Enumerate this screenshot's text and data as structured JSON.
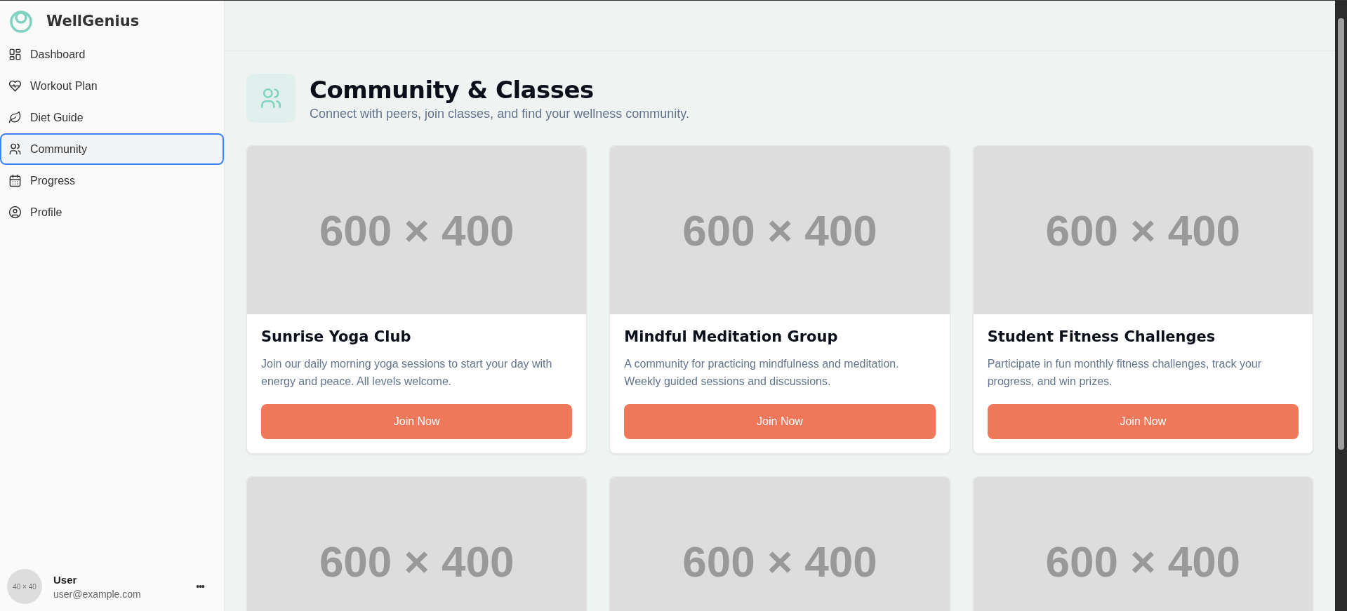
{
  "sidebar": {
    "brand": "WellGenius",
    "items": [
      {
        "label": "Dashboard",
        "selected": false
      },
      {
        "label": "Workout Plan",
        "selected": false
      },
      {
        "label": "Diet Guide",
        "selected": false
      },
      {
        "label": "Community",
        "selected": true
      },
      {
        "label": "Progress",
        "selected": false
      },
      {
        "label": "Profile",
        "selected": false
      }
    ],
    "user": {
      "avatar_label": "40 × 40",
      "name": "User",
      "email": "user@example.com",
      "menu": "•••"
    }
  },
  "page": {
    "title": "Community & Classes",
    "subtitle": "Connect with peers, join classes, and find your wellness community."
  },
  "cards": [
    {
      "image_label": "600 × 400",
      "title": "Sunrise Yoga Club",
      "description": "Join our daily morning yoga sessions to start your day with energy and peace. All levels welcome.",
      "button": "Join Now"
    },
    {
      "image_label": "600 × 400",
      "title": "Mindful Meditation Group",
      "description": "A community for practicing mindfulness and meditation. Weekly guided sessions and discussions.",
      "button": "Join Now"
    },
    {
      "image_label": "600 × 400",
      "title": "Student Fitness Challenges",
      "description": "Participate in fun monthly fitness challenges, track your progress, and win prizes.",
      "button": "Join Now"
    },
    {
      "image_label": "600 × 400"
    },
    {
      "image_label": "600 × 400"
    },
    {
      "image_label": "600 × 400"
    }
  ]
}
